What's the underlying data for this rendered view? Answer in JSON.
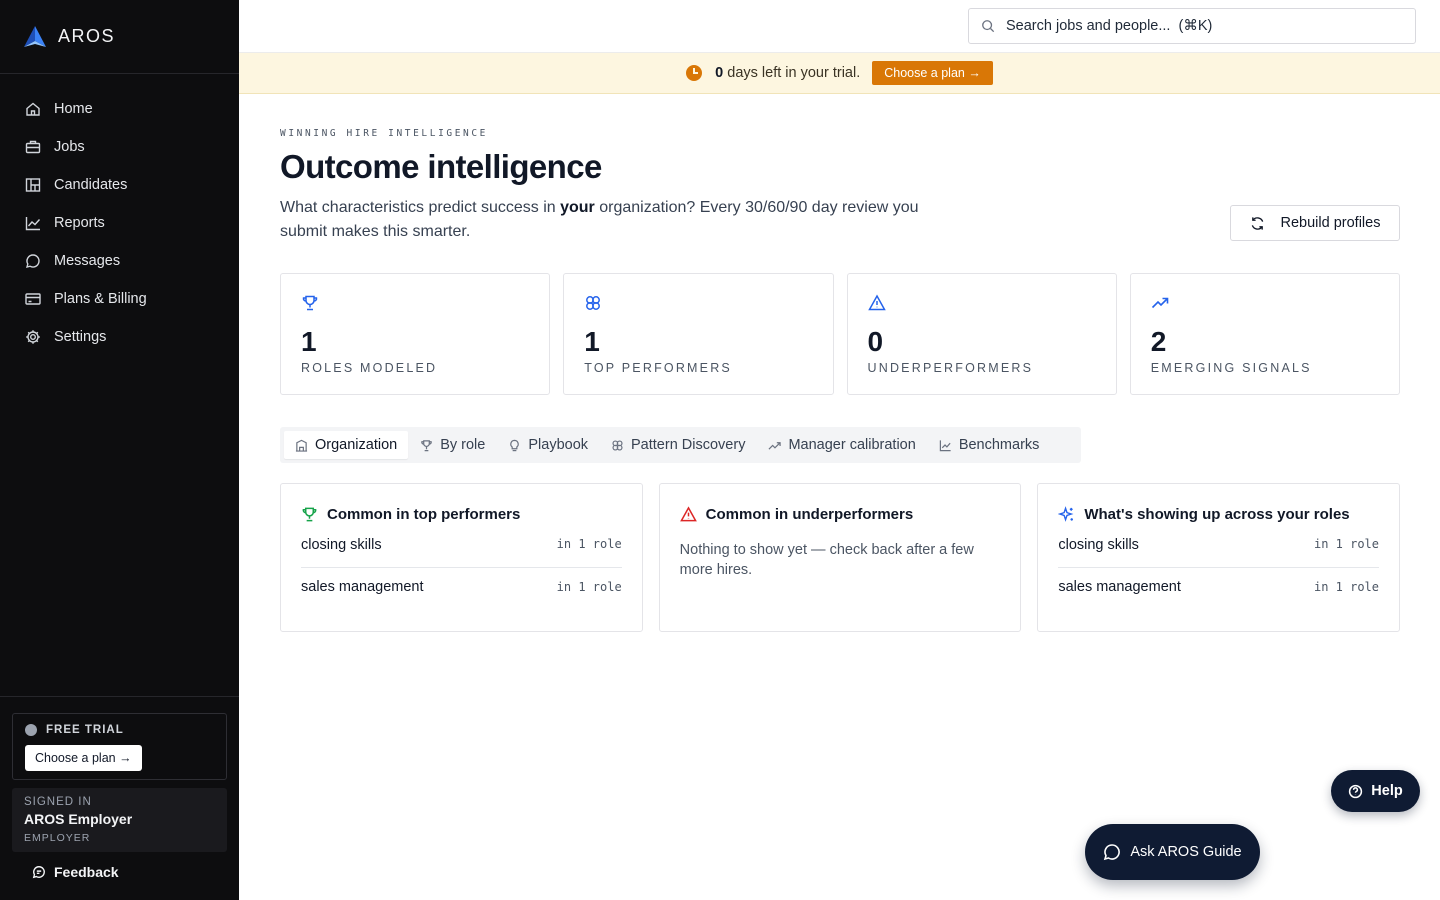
{
  "brand": {
    "name": "AROS",
    "color": "#1d72e8"
  },
  "sidebar": {
    "items": [
      {
        "label": "Home",
        "icon": "home-icon"
      },
      {
        "label": "Jobs",
        "icon": "briefcase-icon"
      },
      {
        "label": "Candidates",
        "icon": "users-grid-icon"
      },
      {
        "label": "Reports",
        "icon": "chart-line-icon"
      },
      {
        "label": "Messages",
        "icon": "message-icon"
      },
      {
        "label": "Plans & Billing",
        "icon": "credit-card-icon"
      },
      {
        "label": "Settings",
        "icon": "gear-icon"
      }
    ],
    "trial": {
      "label": "FREE TRIAL",
      "button": "Choose a plan →"
    },
    "signed_in": {
      "label": "SIGNED IN",
      "name": "AROS Employer",
      "role": "EMPLOYER"
    },
    "feedback": "Feedback"
  },
  "search": {
    "placeholder": "Search jobs and people...  (⌘K)"
  },
  "banner": {
    "days": "0",
    "text": " days left in your trial.",
    "button": "Choose a plan →",
    "color": "#d97706"
  },
  "page": {
    "eyebrow": "WINNING HIRE INTELLIGENCE",
    "title": "Outcome intelligence",
    "subtitle_pre": "What characteristics predict success in ",
    "subtitle_bold": "your",
    "subtitle_post": " organization? Every 30/60/90 day review you submit makes this smarter.",
    "rebuild_button": "Rebuild profiles"
  },
  "stats": [
    {
      "value": "1",
      "label": "ROLES MODELED",
      "icon": "trophy-icon"
    },
    {
      "value": "1",
      "label": "TOP PERFORMERS",
      "icon": "brain-icon"
    },
    {
      "value": "0",
      "label": "UNDERPERFORMERS",
      "icon": "warning-icon"
    },
    {
      "value": "2",
      "label": "EMERGING SIGNALS",
      "icon": "trending-up-icon"
    }
  ],
  "tabs": [
    {
      "label": "Organization",
      "active": true
    },
    {
      "label": "By role"
    },
    {
      "label": "Playbook"
    },
    {
      "label": "Pattern Discovery"
    },
    {
      "label": "Manager calibration"
    },
    {
      "label": "Benchmarks"
    }
  ],
  "cards": {
    "top": {
      "title": "Common in top performers",
      "rows": [
        {
          "name": "closing skills",
          "meta": "in 1 role"
        },
        {
          "name": "sales management",
          "meta": "in 1 role"
        }
      ]
    },
    "under": {
      "title": "Common in underperformers",
      "empty": "Nothing to show yet — check back after a few more hires."
    },
    "emerging": {
      "title": "What's showing up across your roles",
      "rows": [
        {
          "name": "closing skills",
          "meta": "in 1 role"
        },
        {
          "name": "sales management",
          "meta": "in 1 role"
        }
      ]
    }
  },
  "help_button": "Help",
  "guide_button": "Ask AROS Guide",
  "colors": {
    "accent": "#2563eb",
    "success": "#16a34a",
    "danger": "#dc2626",
    "navy": "#0f1b33"
  }
}
